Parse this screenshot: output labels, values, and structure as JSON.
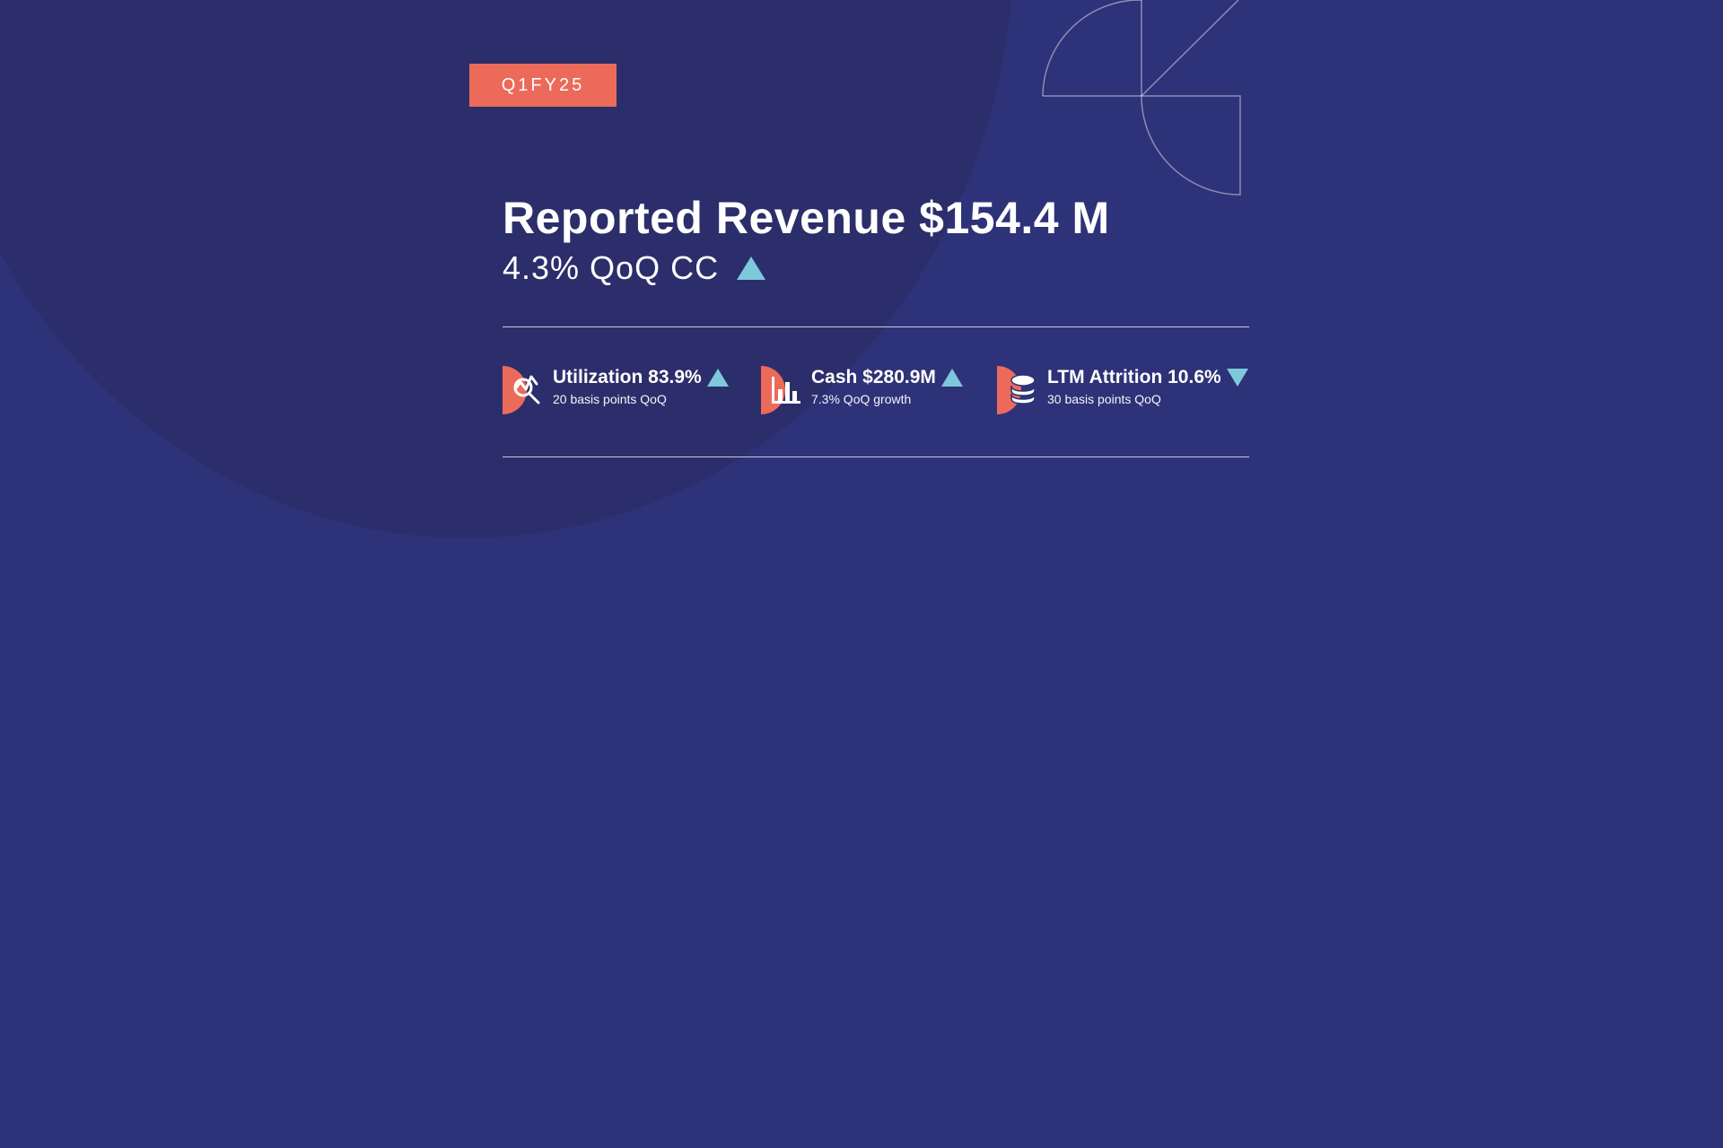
{
  "slide": {
    "tag": "Q1FY25",
    "title": "Reported Revenue $154.4 M",
    "subtitle": "4.3% QoQ CC"
  },
  "metrics": [
    {
      "icon": "magnifier-chart-icon",
      "label": "Utilization 83.9%",
      "sub": "20 basis points QoQ",
      "trend": "up"
    },
    {
      "icon": "bar-chart-icon",
      "label": "Cash $280.9M",
      "sub": "7.3% QoQ growth",
      "trend": "up"
    },
    {
      "icon": "database-icon",
      "label": "LTM Attrition 10.6%",
      "sub": "30 basis points QoQ",
      "trend": "down"
    }
  ],
  "colors": {
    "background": "#2e3278",
    "accent": "#ec6a5a",
    "trend": "#7ec8dc"
  }
}
